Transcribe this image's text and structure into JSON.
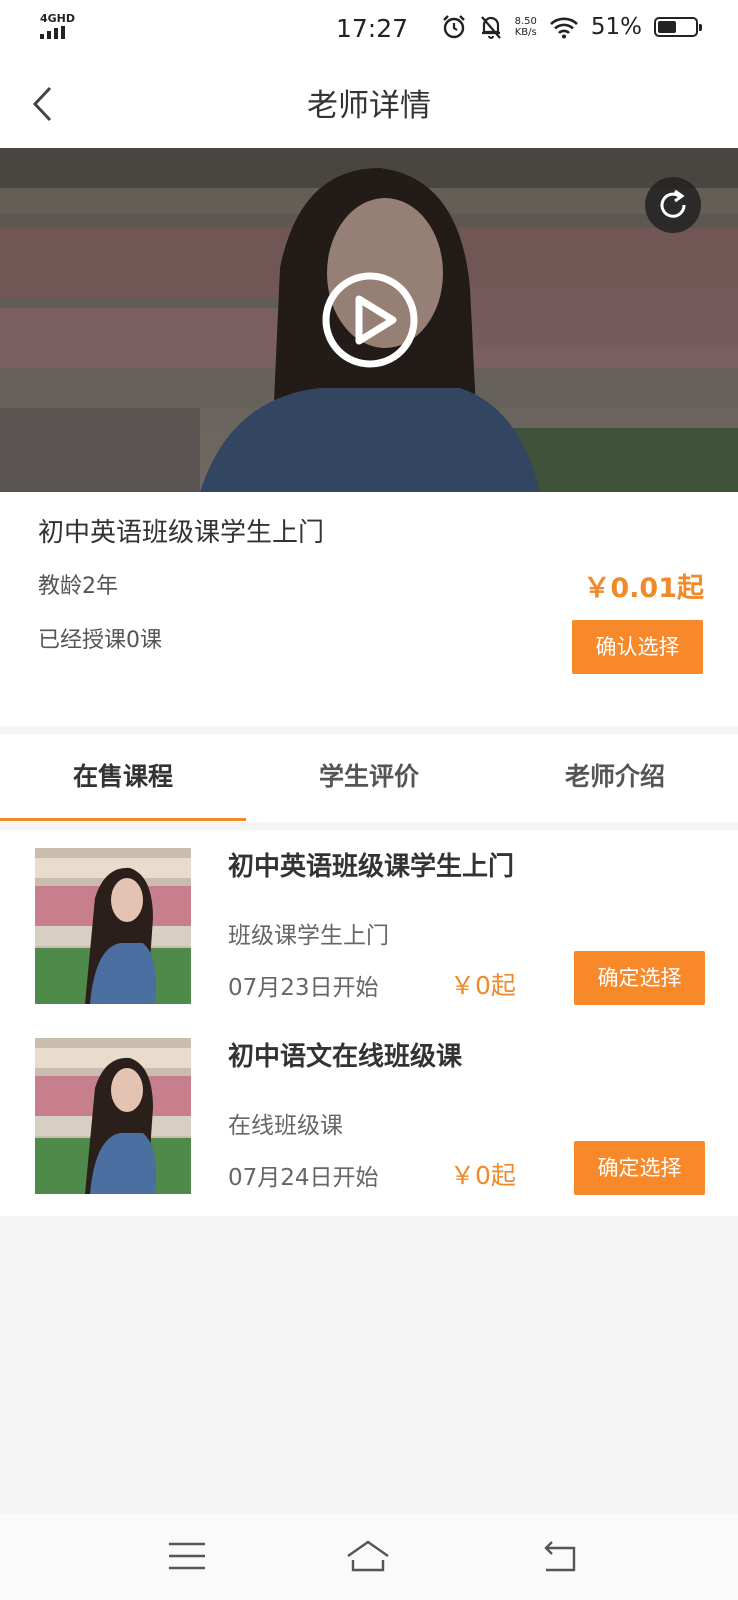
{
  "status_bar": {
    "network": "4GHD",
    "time": "17:27",
    "speed_value": "8.50",
    "speed_unit": "KB/s",
    "battery_percent": "51%",
    "battery_level": 0.51
  },
  "header": {
    "title": "老师详情",
    "back_icon": "chevron-left-icon"
  },
  "video": {
    "play_icon": "play-circle-icon",
    "replay_icon": "replay-icon"
  },
  "teacher": {
    "course_title": "初中英语班级课学生上门",
    "teaching_years": "教龄2年",
    "taught_count": "已经授课0课",
    "price": "￥0.01起",
    "confirm_label": "确认选择"
  },
  "tabs": [
    {
      "label": "在售课程",
      "active": true
    },
    {
      "label": "学生评价",
      "active": false
    },
    {
      "label": "老师介绍",
      "active": false
    }
  ],
  "courses": [
    {
      "title": "初中英语班级课学生上门",
      "subtitle": "班级课学生上门",
      "start_date": "07月23日开始",
      "price": "￥0起",
      "button_label": "确定选择"
    },
    {
      "title": "初中语文在线班级课",
      "subtitle": "在线班级课",
      "start_date": "07月24日开始",
      "price": "￥0起",
      "button_label": "确定选择"
    }
  ],
  "system_nav": {
    "menu_icon": "menu-icon",
    "home_icon": "home-icon",
    "back_icon": "back-icon"
  },
  "colors": {
    "accent": "#f7892b",
    "price": "#f0892a"
  }
}
